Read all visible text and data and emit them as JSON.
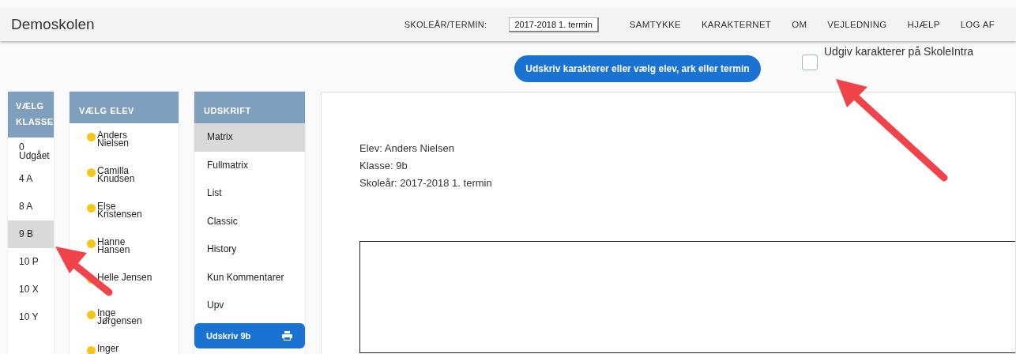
{
  "header": {
    "title": "Demoskolen",
    "term_label": "SKOLEÅR/TERMIN:",
    "term_value": "2017-2018 1. termin",
    "nav": [
      "SAMTYKKE",
      "KARAKTERNET",
      "OM",
      "VEJLEDNING",
      "HJÆLP",
      "LOG AF"
    ]
  },
  "action_button": "Udskriv karakterer eller vælg elev, ark eller termin",
  "publish": {
    "label": "Udgiv karakterer på SkoleIntra",
    "checked": false
  },
  "classes": {
    "title": "VÆLG KLASSE",
    "items": [
      {
        "label": "0 Udgået",
        "selected": false
      },
      {
        "label": "4 A",
        "selected": false
      },
      {
        "label": "8 A",
        "selected": false
      },
      {
        "label": "9 B",
        "selected": true
      },
      {
        "label": "10 P",
        "selected": false
      },
      {
        "label": "10 X",
        "selected": false
      },
      {
        "label": "10 Y",
        "selected": false
      }
    ]
  },
  "students": {
    "title": "VÆLG ELEV",
    "items": [
      {
        "name": "Anders Nielsen"
      },
      {
        "name": "Camilla Knudsen"
      },
      {
        "name": "Else Kristensen"
      },
      {
        "name": "Hanne Hansen"
      },
      {
        "name": "Helle Jensen"
      },
      {
        "name": "Inge Jørgensen"
      },
      {
        "name": "Inger"
      }
    ]
  },
  "printout": {
    "title": "UDSKRIFT",
    "items": [
      {
        "label": "Matrix",
        "selected": true
      },
      {
        "label": "Fullmatrix",
        "selected": false
      },
      {
        "label": "List",
        "selected": false
      },
      {
        "label": "Classic",
        "selected": false
      },
      {
        "label": "History",
        "selected": false
      },
      {
        "label": "Kun Kommentarer",
        "selected": false
      },
      {
        "label": "Upv",
        "selected": false
      }
    ],
    "print_button": "Udskriv 9b"
  },
  "report": {
    "lines": [
      "Elev: Anders Nielsen",
      "Klasse: 9b",
      "Skoleår: 2017-2018 1. termin"
    ]
  }
}
